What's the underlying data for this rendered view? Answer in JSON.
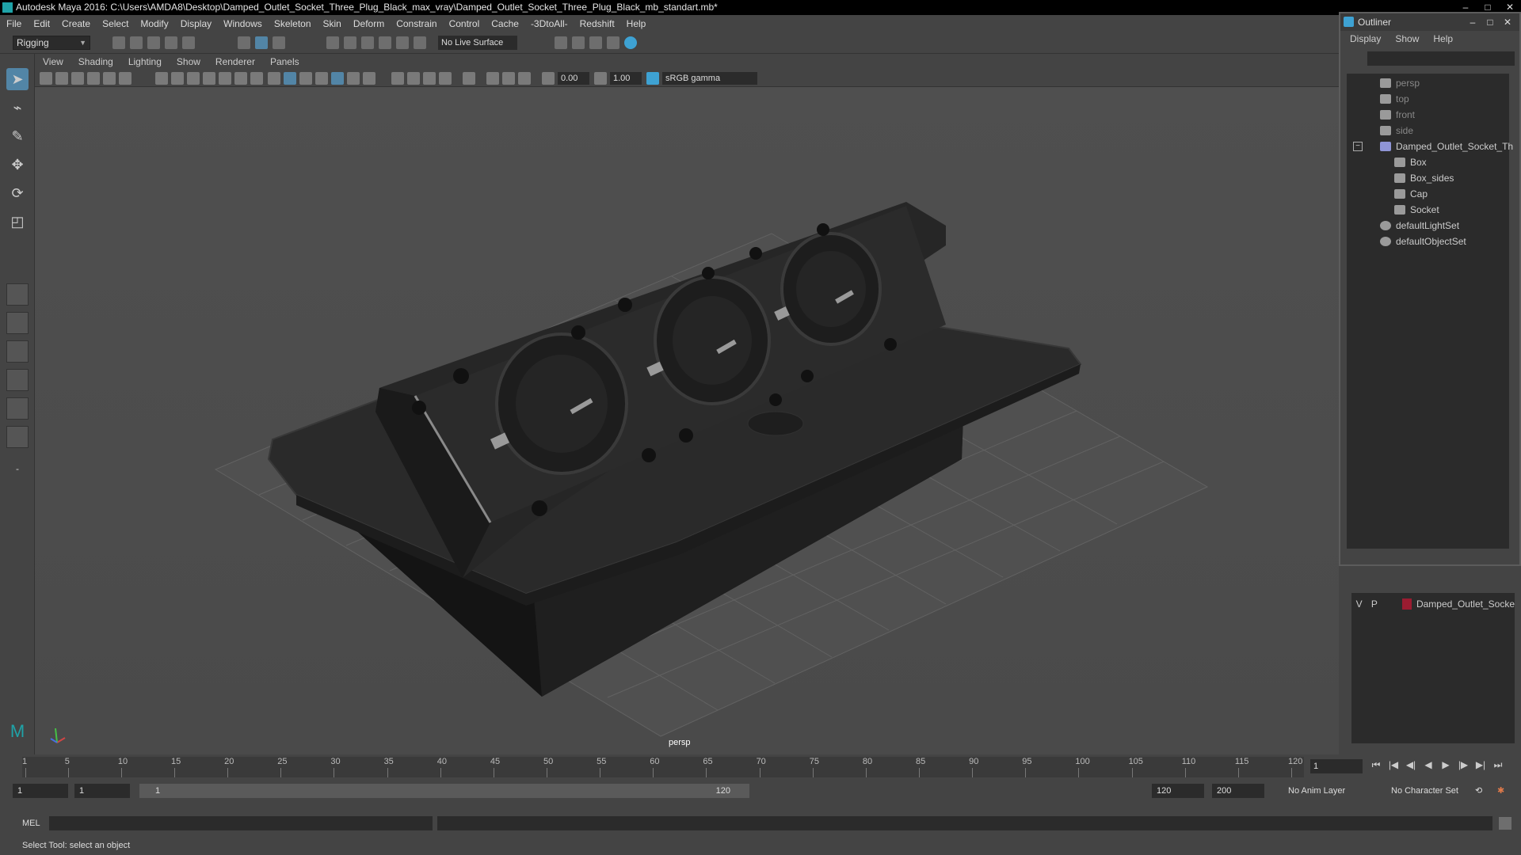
{
  "app": {
    "title": "Autodesk Maya 2016: C:\\Users\\AMDA8\\Desktop\\Damped_Outlet_Socket_Three_Plug_Black_max_vray\\Damped_Outlet_Socket_Three_Plug_Black_mb_standart.mb*"
  },
  "menubar": [
    "File",
    "Edit",
    "Create",
    "Select",
    "Modify",
    "Display",
    "Windows",
    "Skeleton",
    "Skin",
    "Deform",
    "Constrain",
    "Control",
    "Cache",
    "-3DtoAll-",
    "Redshift",
    "Help"
  ],
  "shelf": {
    "mode": "Rigging",
    "live_surface": "No Live Surface"
  },
  "panel": {
    "menu": [
      "View",
      "Shading",
      "Lighting",
      "Show",
      "Renderer",
      "Panels"
    ],
    "exposure": "0.00",
    "gamma": "1.00",
    "color_space": "sRGB gamma",
    "camera_label": "persp"
  },
  "outliner": {
    "title": "Outliner",
    "menu": [
      "Display",
      "Show",
      "Help"
    ],
    "items": [
      "persp",
      "top",
      "front",
      "side",
      "Damped_Outlet_Socket_Th",
      "Box",
      "Box_sides",
      "Cap",
      "Socket",
      "defaultLightSet",
      "defaultObjectSet"
    ]
  },
  "layers": {
    "row": {
      "v": "V",
      "p": "P",
      "name": "Damped_Outlet_Socke",
      "color": "#9b1c31"
    }
  },
  "timeline": {
    "ticks": [
      "1",
      "5",
      "10",
      "15",
      "20",
      "25",
      "30",
      "35",
      "40",
      "45",
      "50",
      "55",
      "60",
      "65",
      "70",
      "75",
      "80",
      "85",
      "90",
      "95",
      "100",
      "105",
      "110",
      "115",
      "120"
    ],
    "current_frame": "1"
  },
  "range": {
    "start": "1",
    "start2": "1",
    "slider_start": "1",
    "slider_end": "120",
    "end": "120",
    "end2": "200",
    "anim_layer": "No Anim Layer",
    "char_set": "No Character Set"
  },
  "cmd": {
    "label": "MEL"
  },
  "help": {
    "text": "Select Tool: select an object"
  },
  "colors": {
    "accent": "#5285a6",
    "viewport_bg": "#4d4d4d",
    "model": "#232323"
  }
}
